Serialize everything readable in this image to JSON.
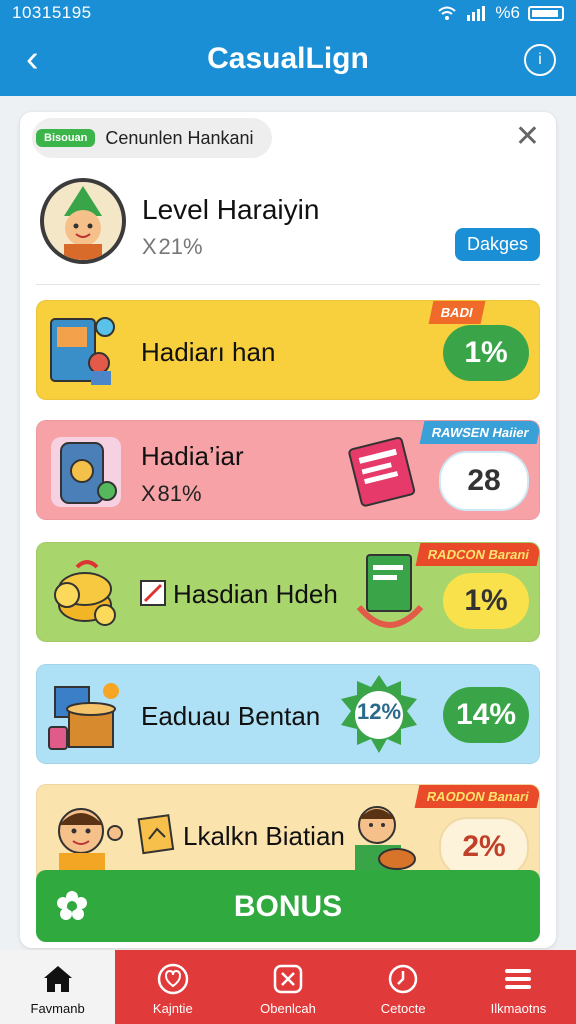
{
  "status": {
    "time": "10315195",
    "net": "%6"
  },
  "appbar": {
    "title": "CasualLign"
  },
  "chip": {
    "tag": "Bisouan",
    "text": "Cenunlen Hankani"
  },
  "level": {
    "title": "Level Haraiyin",
    "sub": "X 21%",
    "button": "Dakges"
  },
  "rows": [
    {
      "label": "Hadiarı han",
      "ribbon": "BADI",
      "badge": "1%",
      "bg": "#f8cf3c",
      "badge_bg": "#3aa548"
    },
    {
      "label": "Hadia’iar",
      "sub": "X 81%",
      "ribbon": "RAWSEN Haiier",
      "badge": "28",
      "bg": "#f7a2a7",
      "badge_bg": "#ffffff"
    },
    {
      "label": "Hasdian Hdeh",
      "ribbon": "RADCON Barani",
      "badge": "1%",
      "bg": "#a8d56c",
      "badge_bg": "#f8e14a"
    },
    {
      "label": "Eaduau Bentan",
      "sticker": "12%",
      "badge": "14%",
      "bg": "#aee0f6",
      "badge_bg": "#3aa548"
    },
    {
      "label": "Lkalkn Biatian",
      "ribbon": "RAODON Banari",
      "badge": "2%",
      "bg": "#fbe3ad",
      "badge_bg": "#fdf2da"
    }
  ],
  "bonus": {
    "label": "BONUS"
  },
  "nav": [
    {
      "label": "Favmanb",
      "icon": "home-icon"
    },
    {
      "label": "Kajntie",
      "icon": "heart-icon"
    },
    {
      "label": "Obenlcah",
      "icon": "gift-icon"
    },
    {
      "label": "Cetocte",
      "icon": "clock-icon"
    },
    {
      "label": "Ilkmaotns",
      "icon": "menu-icon"
    }
  ],
  "colors": {
    "accent": "#1a8fd6",
    "nav": "#e03a3a",
    "bonus": "#30a93f"
  }
}
